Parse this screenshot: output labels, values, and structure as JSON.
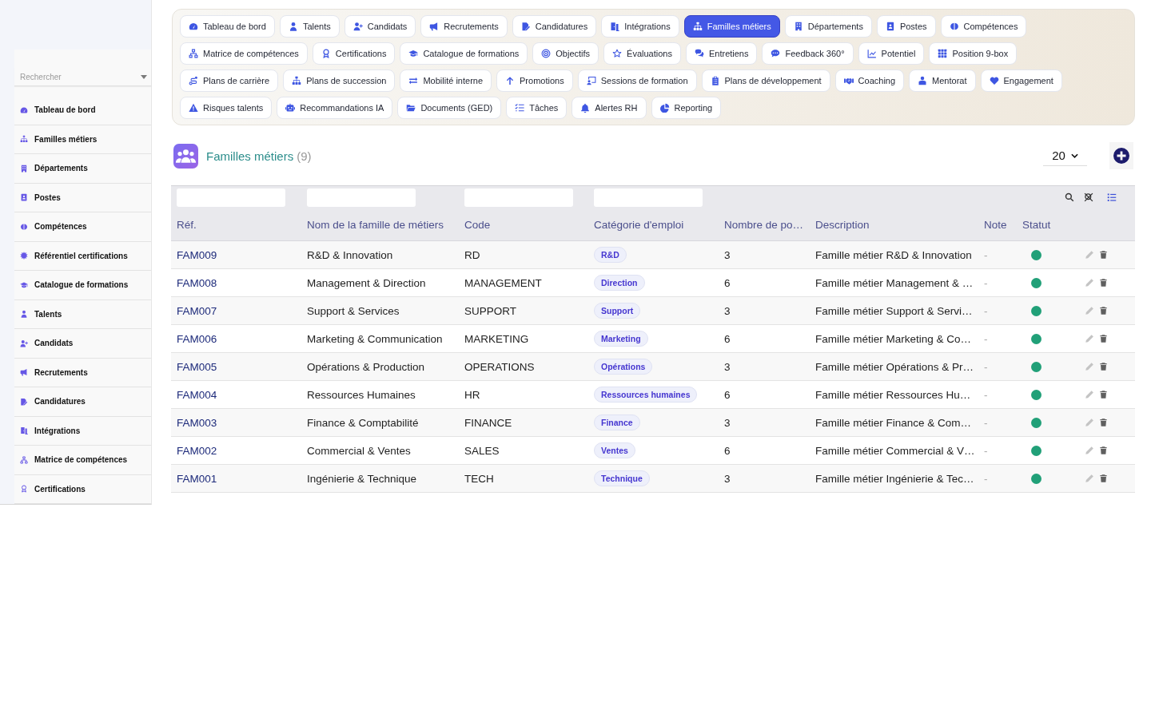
{
  "sidebar": {
    "search": {
      "placeholder": "Rechercher"
    },
    "items": [
      {
        "label": "Tableau de bord"
      },
      {
        "label": "Familles métiers"
      },
      {
        "label": "Départements"
      },
      {
        "label": "Postes"
      },
      {
        "label": "Compétences"
      },
      {
        "label": "Référentiel certifications"
      },
      {
        "label": "Catalogue de formations"
      },
      {
        "label": "Talents"
      },
      {
        "label": "Candidats"
      },
      {
        "label": "Recrutements"
      },
      {
        "label": "Candidatures"
      },
      {
        "label": "Intégrations"
      },
      {
        "label": "Matrice de compétences"
      },
      {
        "label": "Certifications"
      }
    ]
  },
  "tabs": [
    {
      "label": "Tableau de bord",
      "selected": false
    },
    {
      "label": "Talents",
      "selected": false
    },
    {
      "label": "Candidats",
      "selected": false
    },
    {
      "label": "Recrutements",
      "selected": false
    },
    {
      "label": "Candidatures",
      "selected": false
    },
    {
      "label": "Intégrations",
      "selected": false
    },
    {
      "label": "Familles métiers",
      "selected": true
    },
    {
      "label": "Départements",
      "selected": false
    },
    {
      "label": "Postes",
      "selected": false
    },
    {
      "label": "Compétences",
      "selected": false
    },
    {
      "label": "Matrice de compétences",
      "selected": false
    },
    {
      "label": "Certifications",
      "selected": false
    },
    {
      "label": "Catalogue de formations",
      "selected": false
    },
    {
      "label": "Objectifs",
      "selected": false
    },
    {
      "label": "Évaluations",
      "selected": false
    },
    {
      "label": "Entretiens",
      "selected": false
    },
    {
      "label": "Feedback 360°",
      "selected": false
    },
    {
      "label": "Potentiel",
      "selected": false
    },
    {
      "label": "Position 9-box",
      "selected": false
    },
    {
      "label": "Plans de carrière",
      "selected": false
    },
    {
      "label": "Plans de succession",
      "selected": false
    },
    {
      "label": "Mobilité interne",
      "selected": false
    },
    {
      "label": "Promotions",
      "selected": false
    },
    {
      "label": "Sessions de formation",
      "selected": false
    },
    {
      "label": "Plans de développement",
      "selected": false
    },
    {
      "label": "Coaching",
      "selected": false
    },
    {
      "label": "Mentorat",
      "selected": false
    },
    {
      "label": "Engagement",
      "selected": false
    },
    {
      "label": "Risques talents",
      "selected": false
    },
    {
      "label": "Recommandations IA",
      "selected": false
    },
    {
      "label": "Documents (GED)",
      "selected": false
    },
    {
      "label": "Tâches",
      "selected": false
    },
    {
      "label": "Alertes RH",
      "selected": false
    },
    {
      "label": "Reporting",
      "selected": false
    }
  ],
  "header": {
    "title": "Familles métiers",
    "count": "(9)",
    "page_size": "20"
  },
  "table": {
    "columns": [
      {
        "label": "Réf.",
        "filterable": true
      },
      {
        "label": "Nom de la famille de métiers",
        "filterable": true
      },
      {
        "label": "Code",
        "filterable": true
      },
      {
        "label": "Catégorie d'emploi",
        "filterable": true
      },
      {
        "label": "Nombre de po…",
        "filterable": false
      },
      {
        "label": "Description",
        "filterable": false
      },
      {
        "label": "Note",
        "filterable": false
      },
      {
        "label": "Statut",
        "filterable": false
      }
    ],
    "rows": [
      {
        "ref": "FAM009",
        "name": "R&D & Innovation",
        "code": "RD",
        "category": "R&D",
        "positions": "3",
        "description": "Famille métier R&D & Innovation",
        "note": "-",
        "active": true
      },
      {
        "ref": "FAM008",
        "name": "Management & Direction",
        "code": "MANAGEMENT",
        "category": "Direction",
        "positions": "6",
        "description": "Famille métier Management & …",
        "note": "-",
        "active": true
      },
      {
        "ref": "FAM007",
        "name": "Support & Services",
        "code": "SUPPORT",
        "category": "Support",
        "positions": "3",
        "description": "Famille métier Support & Servi…",
        "note": "-",
        "active": true
      },
      {
        "ref": "FAM006",
        "name": "Marketing & Communication",
        "code": "MARKETING",
        "category": "Marketing",
        "positions": "6",
        "description": "Famille métier Marketing & Co…",
        "note": "-",
        "active": true
      },
      {
        "ref": "FAM005",
        "name": "Opérations & Production",
        "code": "OPERATIONS",
        "category": "Opérations",
        "positions": "3",
        "description": "Famille métier Opérations & Pr…",
        "note": "-",
        "active": true
      },
      {
        "ref": "FAM004",
        "name": "Ressources Humaines",
        "code": "HR",
        "category": "Ressources humaines",
        "positions": "6",
        "description": "Famille métier Ressources Hu…",
        "note": "-",
        "active": true
      },
      {
        "ref": "FAM003",
        "name": "Finance & Comptabilité",
        "code": "FINANCE",
        "category": "Finance",
        "positions": "3",
        "description": "Famille métier Finance & Com…",
        "note": "-",
        "active": true
      },
      {
        "ref": "FAM002",
        "name": "Commercial & Ventes",
        "code": "SALES",
        "category": "Ventes",
        "positions": "6",
        "description": "Famille métier Commercial & V…",
        "note": "-",
        "active": true
      },
      {
        "ref": "FAM001",
        "name": "Ingénierie & Technique",
        "code": "TECH",
        "category": "Technique",
        "positions": "3",
        "description": "Famille métier Ingénierie & Tec…",
        "note": "-",
        "active": true
      }
    ]
  }
}
